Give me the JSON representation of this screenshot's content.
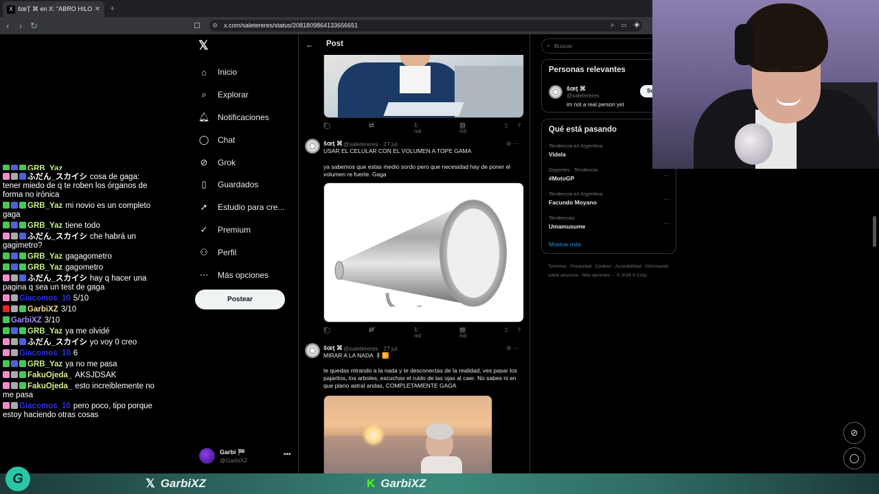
{
  "browser": {
    "tab_title": "šœŢ ⌘ en X: \"ABRO HILO DE TO...",
    "url": "x.com/saletereres/status/2081809864133656651"
  },
  "chat": [
    {
      "badges": [
        "green",
        "blue",
        "green"
      ],
      "user": "GRB_Yaz",
      "user_class": "u-yaz",
      "text": "",
      "cut": true
    },
    {
      "badges": [
        "pink",
        "gray",
        "blue"
      ],
      "user": "ふだん_スカイシ",
      "user_class": "u-jp",
      "text": "cosa de gaga: tener miedo de q te roben los órganos de forma no irónica"
    },
    {
      "badges": [
        "green",
        "blue",
        "green"
      ],
      "user": "GRB_Yaz",
      "user_class": "u-yaz",
      "text": "mi novio es un completo gaga"
    },
    {
      "badges": [
        "green",
        "blue",
        "green"
      ],
      "user": "GRB_Yaz",
      "user_class": "u-yaz",
      "text": "tiene todo"
    },
    {
      "badges": [
        "pink",
        "gray",
        "blue"
      ],
      "user": "ふだん_スカイシ",
      "user_class": "u-jp",
      "text": "che habrá un gagimetro?"
    },
    {
      "badges": [
        "green",
        "blue",
        "green"
      ],
      "user": "GRB_Yaz",
      "user_class": "u-yaz",
      "text": "gagagometro"
    },
    {
      "badges": [
        "green",
        "blue",
        "green"
      ],
      "user": "GRB_Yaz",
      "user_class": "u-yaz",
      "text": "gagometro"
    },
    {
      "badges": [
        "pink",
        "gray",
        "blue"
      ],
      "user": "ふだん_スカイシ",
      "user_class": "u-jp",
      "text": "hay q hacer una pagina q sea un test de gaga"
    },
    {
      "badges": [
        "pink",
        "gray"
      ],
      "user": "Giacomos_10",
      "user_class": "u-giac",
      "text": "5/10"
    },
    {
      "badges": [
        "red",
        "gray",
        "green"
      ],
      "user": "GarbiXZ",
      "user_class": "u-garbi2",
      "text": "3/10"
    },
    {
      "badges": [
        "green"
      ],
      "user": "GarbiXZ",
      "user_class": "u-garbi",
      "text": "3/10"
    },
    {
      "badges": [
        "green",
        "blue",
        "green"
      ],
      "user": "GRB_Yaz",
      "user_class": "u-yaz",
      "text": "ya me olvidé"
    },
    {
      "badges": [
        "pink",
        "gray",
        "blue"
      ],
      "user": "ふだん_スカイシ",
      "user_class": "u-jp",
      "text": "yo voy 0 creo"
    },
    {
      "badges": [
        "pink",
        "gray"
      ],
      "user": "Giacomos_10",
      "user_class": "u-giac",
      "text": "6"
    },
    {
      "badges": [
        "green",
        "blue",
        "green"
      ],
      "user": "GRB_Yaz",
      "user_class": "u-yaz",
      "text": "ya no me pasa"
    },
    {
      "badges": [
        "pink",
        "gray",
        "green"
      ],
      "user": "FakuOjeda_",
      "user_class": "u-faku",
      "text": "AKSJDSAK"
    },
    {
      "badges": [
        "pink",
        "gray",
        "green"
      ],
      "user": "FakuOjeda_",
      "user_class": "u-faku",
      "text": "esto increiblemente no me pasa"
    },
    {
      "badges": [
        "pink",
        "gray"
      ],
      "user": "Giacomos_10",
      "user_class": "u-giac",
      "text": "pero poco, tipo porque estoy haciendo otras cosas"
    }
  ],
  "sidebar": {
    "items": [
      {
        "label": "Inicio",
        "icon": "⌂",
        "name": "home"
      },
      {
        "label": "Explorar",
        "icon": "⌕",
        "name": "explore"
      },
      {
        "label": "Notificaciones",
        "icon": "🔔︎",
        "name": "notifications"
      },
      {
        "label": "Chat",
        "icon": "◯",
        "name": "chat"
      },
      {
        "label": "Grok",
        "icon": "⊘",
        "name": "grok"
      },
      {
        "label": "Guardados",
        "icon": "▯",
        "name": "bookmarks"
      },
      {
        "label": "Estudio para cre...",
        "icon": "➚",
        "name": "creator-studio"
      },
      {
        "label": "Premium",
        "icon": "✓",
        "name": "premium"
      },
      {
        "label": "Perfil",
        "icon": "⚇",
        "name": "profile"
      },
      {
        "label": "Más opciones",
        "icon": "⋯",
        "name": "more"
      }
    ],
    "post_label": "Postear",
    "account_name": "Garbi 🏁",
    "account_handle": "@GarbiXZ"
  },
  "main": {
    "title": "Post",
    "tweet0_actions": {
      "replies": "2",
      "retweets": "61",
      "likes": "1 mil",
      "views": "73 mil"
    },
    "tweet1": {
      "name": "šœţ ⌘",
      "handle": "@saletereres · 27 jul.",
      "title": "USAR EL CELULAR CON EL VOLUMEN A TOPE GAMA",
      "body": "ya sabemos que estas medio sordo pero que necesidad hay de poner el volumen re fuerte. Gaga",
      "replies": "3",
      "retweets": "47",
      "likes": "1 mil",
      "views": "68 mil"
    },
    "tweet2": {
      "name": "šœţ ⌘",
      "handle": "@saletereres · 27 jul.",
      "title": "MIRAR A LA NADA 🧍‍♂️📴",
      "body": "te quedas mirando a la nada y te desconectas de la realidad, ves pasar los pajaritos, los arboles, escuchas el ruido de las ojas al caer. No sabes ni en que plano astral andas, COMPLETAMENTE GAGA"
    }
  },
  "right": {
    "search_placeholder": "Buscar",
    "relevant_title": "Personas relevantes",
    "relevant_name": "šœţ ⌘",
    "relevant_handle": "@saletereres",
    "relevant_bio": "im not a real person yet",
    "follow_label": "Se",
    "trending_title": "Qué está pasando",
    "trends": [
      {
        "context": "Tendencia en Argentina",
        "name": "Videla"
      },
      {
        "context": "Deportes · Tendencia",
        "name": "#MotoGP"
      },
      {
        "context": "Tendencia en Argentina",
        "name": "Facundo Moyano"
      },
      {
        "context": "Tendencias",
        "name": "Umamusume"
      }
    ],
    "show_more": "Mostrar más",
    "footer": "Términos · Privacidad · Cookies · Accesibilidad · Información sobre anuncios · Más opciones ··· © 2026 X Corp."
  },
  "overlay": {
    "twitter_handle": "GarbiXZ",
    "kick_handle": "GarbiXZ",
    "logo_letter": "G"
  }
}
